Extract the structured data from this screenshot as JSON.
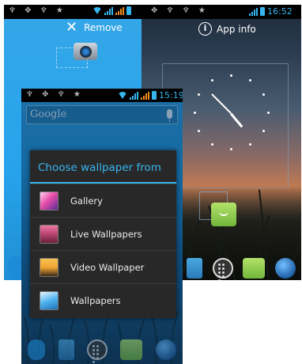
{
  "back_screen": {
    "status_time": "16:52",
    "drop_targets": {
      "remove_label": "Remove",
      "app_info_label": "App info"
    }
  },
  "front_screen": {
    "status_time": "15:19",
    "search_placeholder": "Google"
  },
  "dialog": {
    "title": "Choose wallpaper from",
    "options": [
      {
        "label": "Gallery",
        "icon": "gallery-icon"
      },
      {
        "label": "Live Wallpapers",
        "icon": "live-wallpapers-icon"
      },
      {
        "label": "Video Wallpaper",
        "icon": "video-wallpaper-icon"
      },
      {
        "label": "Wallpapers",
        "icon": "wallpapers-icon"
      }
    ]
  },
  "colors": {
    "accent": "#37b5ee",
    "dialog_bg": "#282828",
    "dialog_text": "#ececec"
  }
}
